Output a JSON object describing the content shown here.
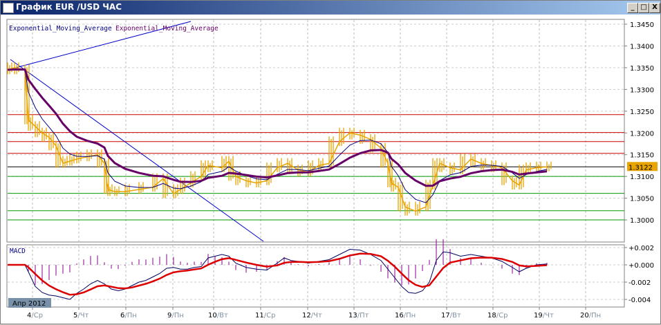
{
  "window": {
    "title": "График EUR /USD  ЧАС",
    "min": "_",
    "max": "□",
    "close": "X"
  },
  "legend": [
    {
      "text": "Exponential_Moving_Average",
      "color": "#000080"
    },
    {
      "text": "Exponential_Moving_Average",
      "color": "#660066"
    }
  ],
  "price_axis": [
    "1.3450",
    "1.3400",
    "1.3350",
    "1.3300",
    "1.3250",
    "1.3200",
    "1.3150",
    "1.3100",
    "1.3050",
    "1.3000"
  ],
  "current_price": "1.3122",
  "macd_label": "MACD",
  "macd_axis": [
    "+0.002",
    "+0.000",
    "-0.002",
    "-0.004"
  ],
  "month_badge": "Апр 2012",
  "dates": [
    {
      "d": "4",
      "w": "Ср"
    },
    {
      "d": "5",
      "w": "Чт"
    },
    {
      "d": "6",
      "w": "Пн"
    },
    {
      "d": "9",
      "w": "Пн"
    },
    {
      "d": "10",
      "w": "Вт"
    },
    {
      "d": "11",
      "w": "Ср"
    },
    {
      "d": "12",
      "w": "Чт"
    },
    {
      "d": "13",
      "w": "Пт"
    },
    {
      "d": "16",
      "w": "Пн"
    },
    {
      "d": "17",
      "w": "Вт"
    },
    {
      "d": "18",
      "w": "Ср"
    },
    {
      "d": "19",
      "w": "Чт"
    },
    {
      "d": "20",
      "w": "Пн"
    }
  ],
  "colors": {
    "bars": "#e8a400",
    "ema_fast": "#000080",
    "ema_slow": "#660066",
    "resistance": "#cc0000",
    "support": "#009900",
    "current": "#000000",
    "macd": "#000060",
    "signal": "#dd0000",
    "hist": "#880088"
  },
  "chart_data": [
    {
      "type": "line",
      "title": "EUR/USD H1",
      "ylim": [
        1.297,
        1.3465
      ],
      "levels": {
        "resistance": [
          1.3242,
          1.3201,
          1.318,
          1.3153
        ],
        "current": 1.3122,
        "support": [
          1.31,
          1.3061,
          1.3021,
          1.3
        ]
      },
      "price": [
        [
          0,
          1.3345
        ],
        [
          1,
          1.335
        ],
        [
          2.5,
          1.3345
        ],
        [
          3,
          1.323
        ],
        [
          4,
          1.3215
        ],
        [
          5,
          1.32
        ],
        [
          6,
          1.319
        ],
        [
          7,
          1.317
        ],
        [
          8,
          1.313
        ],
        [
          9,
          1.3135
        ],
        [
          10,
          1.314
        ],
        [
          11.5,
          1.3145
        ],
        [
          13,
          1.315
        ],
        [
          14,
          1.313
        ],
        [
          14.5,
          1.307
        ],
        [
          15.5,
          1.3065
        ],
        [
          17,
          1.3065
        ],
        [
          19,
          1.307
        ],
        [
          21,
          1.3075
        ],
        [
          22.5,
          1.3095
        ],
        [
          24,
          1.306
        ],
        [
          25,
          1.307
        ],
        [
          26.5,
          1.3085
        ],
        [
          28,
          1.31
        ],
        [
          29,
          1.3125
        ],
        [
          31,
          1.312
        ],
        [
          32,
          1.3135
        ],
        [
          33,
          1.31
        ],
        [
          34.5,
          1.309
        ],
        [
          36,
          1.3085
        ],
        [
          37.5,
          1.309
        ],
        [
          39,
          1.312
        ],
        [
          40.5,
          1.313
        ],
        [
          42,
          1.3115
        ],
        [
          43.5,
          1.311
        ],
        [
          45,
          1.3125
        ],
        [
          46.5,
          1.313
        ],
        [
          48,
          1.318
        ],
        [
          49.5,
          1.32
        ],
        [
          51,
          1.3195
        ],
        [
          52.5,
          1.3185
        ],
        [
          54,
          1.3165
        ],
        [
          55,
          1.313
        ],
        [
          55.5,
          1.3085
        ],
        [
          56.5,
          1.3075
        ],
        [
          57.5,
          1.303
        ],
        [
          59,
          1.302
        ],
        [
          60.5,
          1.303
        ],
        [
          61.5,
          1.308
        ],
        [
          62.5,
          1.313
        ],
        [
          64,
          1.312
        ],
        [
          65.5,
          1.3115
        ],
        [
          67,
          1.314
        ],
        [
          68.5,
          1.313
        ],
        [
          70,
          1.3125
        ],
        [
          71.5,
          1.312
        ],
        [
          73,
          1.309
        ],
        [
          74,
          1.308
        ],
        [
          75,
          1.3115
        ],
        [
          76.5,
          1.312
        ],
        [
          78,
          1.3122
        ]
      ]
    },
    {
      "type": "line",
      "title": "MACD",
      "ylim": [
        -0.0045,
        0.0025
      ],
      "macd": [
        [
          0,
          0
        ],
        [
          2.5,
          0
        ],
        [
          3,
          -0.0008
        ],
        [
          4,
          -0.0025
        ],
        [
          5,
          -0.0032
        ],
        [
          6,
          -0.0035
        ],
        [
          7,
          -0.0036
        ],
        [
          8,
          -0.0038
        ],
        [
          9,
          -0.004
        ],
        [
          10,
          -0.0033
        ],
        [
          11,
          -0.0028
        ],
        [
          12,
          -0.0022
        ],
        [
          13,
          -0.0018
        ],
        [
          14,
          -0.0022
        ],
        [
          15,
          -0.0028
        ],
        [
          16,
          -0.003
        ],
        [
          17,
          -0.0028
        ],
        [
          18,
          -0.0024
        ],
        [
          19,
          -0.002
        ],
        [
          20,
          -0.0018
        ],
        [
          21,
          -0.0014
        ],
        [
          22,
          -0.001
        ],
        [
          23,
          -0.0004
        ],
        [
          24,
          -0.0003
        ],
        [
          25,
          -0.0005
        ],
        [
          26,
          -0.0005
        ],
        [
          27,
          -0.0003
        ],
        [
          28,
          -0.0002
        ],
        [
          29,
          0.0008
        ],
        [
          30,
          0.001
        ],
        [
          31,
          0.0012
        ],
        [
          32,
          0.001
        ],
        [
          33,
          0.0002
        ],
        [
          34.5,
          -0.0003
        ],
        [
          36,
          -0.0005
        ],
        [
          37.5,
          -0.0006
        ],
        [
          39,
          0.0002
        ],
        [
          40,
          0.0008
        ],
        [
          41,
          0.0005
        ],
        [
          42,
          0.0004
        ],
        [
          43.5,
          0.0002
        ],
        [
          45,
          0.0004
        ],
        [
          46.5,
          0.0006
        ],
        [
          48,
          0.0012
        ],
        [
          49.5,
          0.0018
        ],
        [
          51,
          0.0017
        ],
        [
          52.5,
          0.0012
        ],
        [
          54,
          0.0005
        ],
        [
          55,
          -0.0005
        ],
        [
          56,
          -0.0015
        ],
        [
          57,
          -0.0025
        ],
        [
          58,
          -0.0032
        ],
        [
          59,
          -0.0033
        ],
        [
          60,
          -0.003
        ],
        [
          61,
          -0.002
        ],
        [
          62,
          0.0005
        ],
        [
          63,
          0.0015
        ],
        [
          64,
          0.0014
        ],
        [
          65.5,
          0.001
        ],
        [
          67,
          0.0012
        ],
        [
          68.5,
          0.001
        ],
        [
          70,
          0.0008
        ],
        [
          71.5,
          0.0004
        ],
        [
          73,
          -0.0003
        ],
        [
          74,
          -0.0008
        ],
        [
          75,
          -0.0004
        ],
        [
          76.5,
          0
        ],
        [
          78,
          0.0001
        ]
      ]
    }
  ]
}
